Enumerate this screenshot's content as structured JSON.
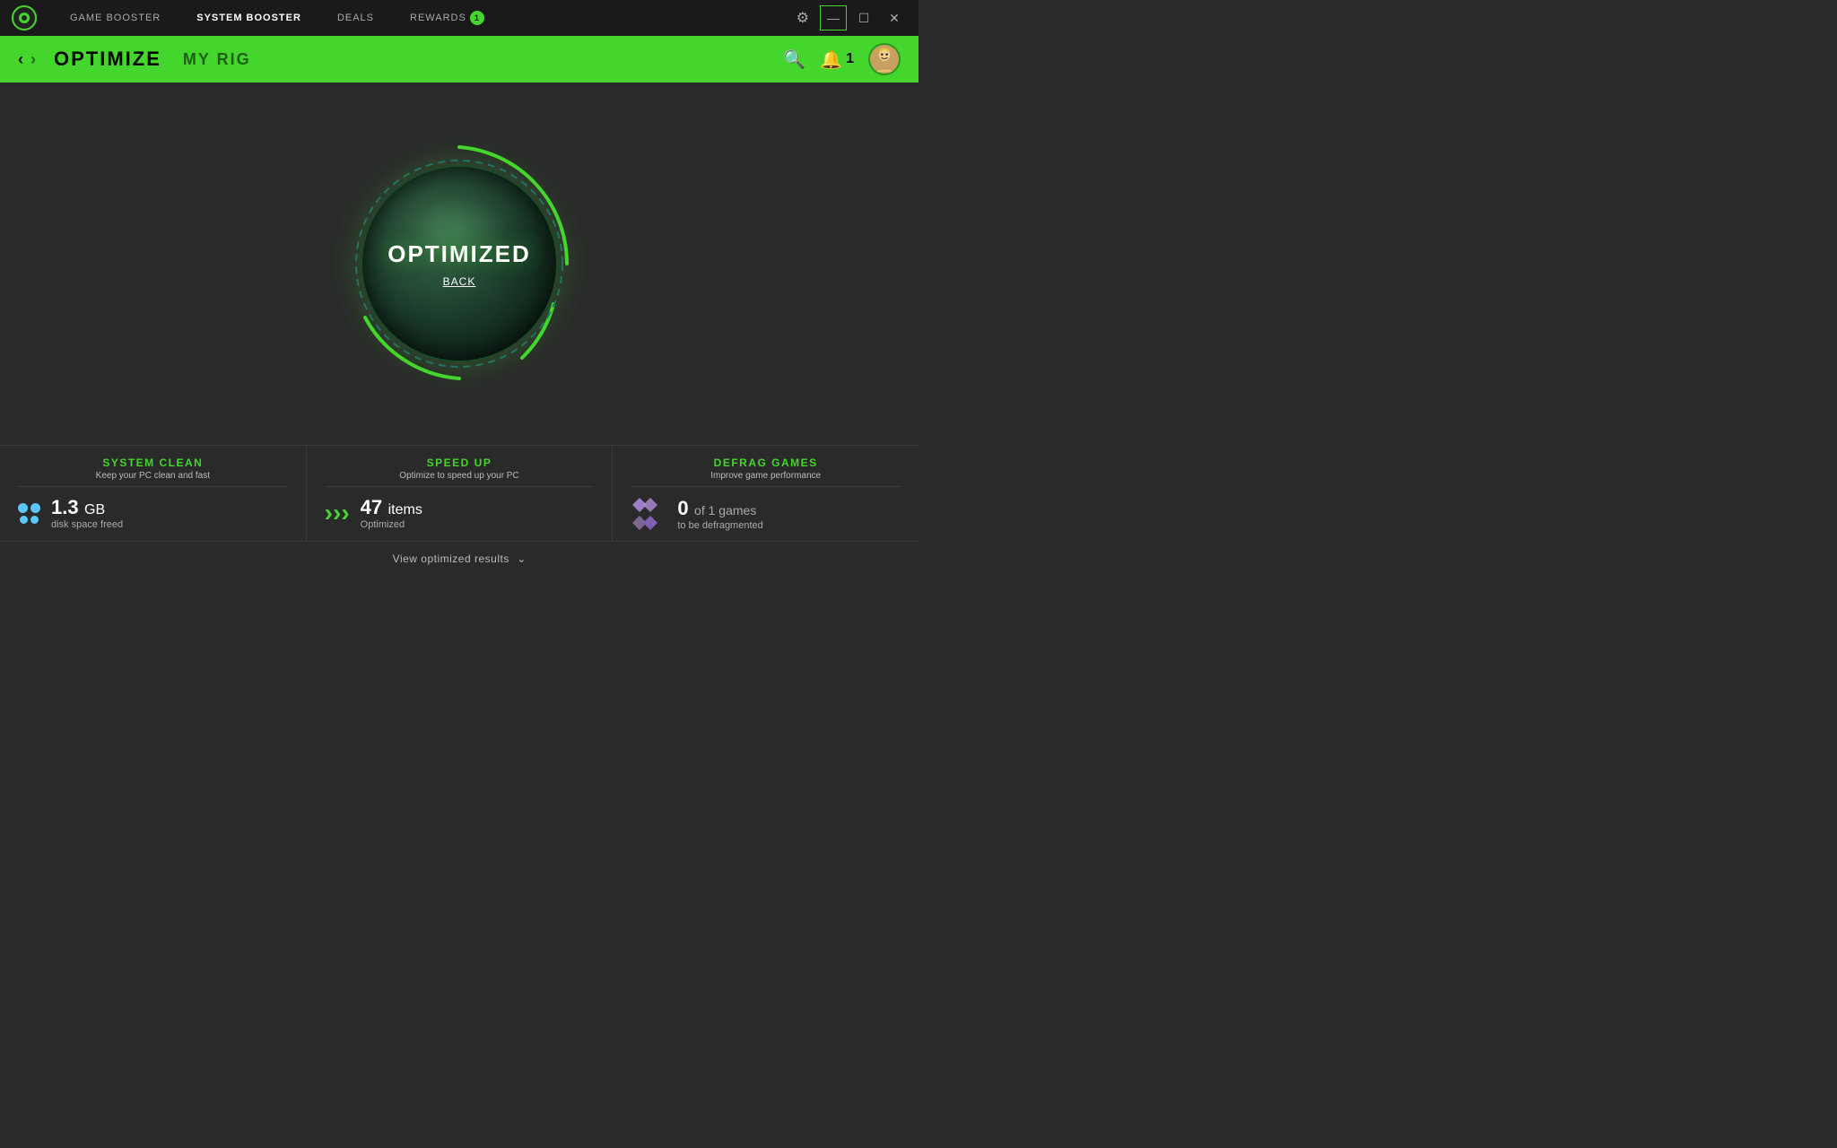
{
  "app": {
    "logo_alt": "Razer Cortex Logo"
  },
  "topnav": {
    "items": [
      {
        "id": "game-booster",
        "label": "GAME BOOSTER",
        "active": false
      },
      {
        "id": "system-booster",
        "label": "SYSTEM BOOSTER",
        "active": true
      },
      {
        "id": "deals",
        "label": "DEALS",
        "active": false
      },
      {
        "id": "rewards",
        "label": "REWARDS",
        "active": false,
        "badge": "1"
      }
    ],
    "gear_title": "Settings",
    "minimize_label": "—",
    "restore_label": "☐",
    "close_label": "✕"
  },
  "subheader": {
    "back_arrow": "‹",
    "forward_arrow": "›",
    "crumb_active": "OPTIMIZE",
    "crumb_inactive": "MY RIG",
    "search_icon": "🔍",
    "bell_count": "1",
    "avatar_alt": "User Avatar"
  },
  "main": {
    "optimized_label": "OPTIMIZED",
    "back_link": "BACK"
  },
  "stats": [
    {
      "id": "system-clean",
      "title": "SYSTEM CLEAN",
      "subtitle": "Keep your PC clean and fast",
      "icon_type": "dots",
      "value": "1.3",
      "unit": "GB",
      "label": "disk space freed"
    },
    {
      "id": "speed-up",
      "title": "SPEED UP",
      "subtitle": "Optimize to speed up your PC",
      "icon_type": "arrows",
      "value": "47",
      "unit": "items",
      "label": "Optimized"
    },
    {
      "id": "defrag-games",
      "title": "DEFRAG GAMES",
      "subtitle": "Improve game performance",
      "icon_type": "diamond",
      "value": "0",
      "unit": "",
      "value2": "of 1 games",
      "label": "to be defragmented"
    }
  ],
  "view_results": {
    "label": "View optimized results",
    "arrow": "⌄"
  }
}
